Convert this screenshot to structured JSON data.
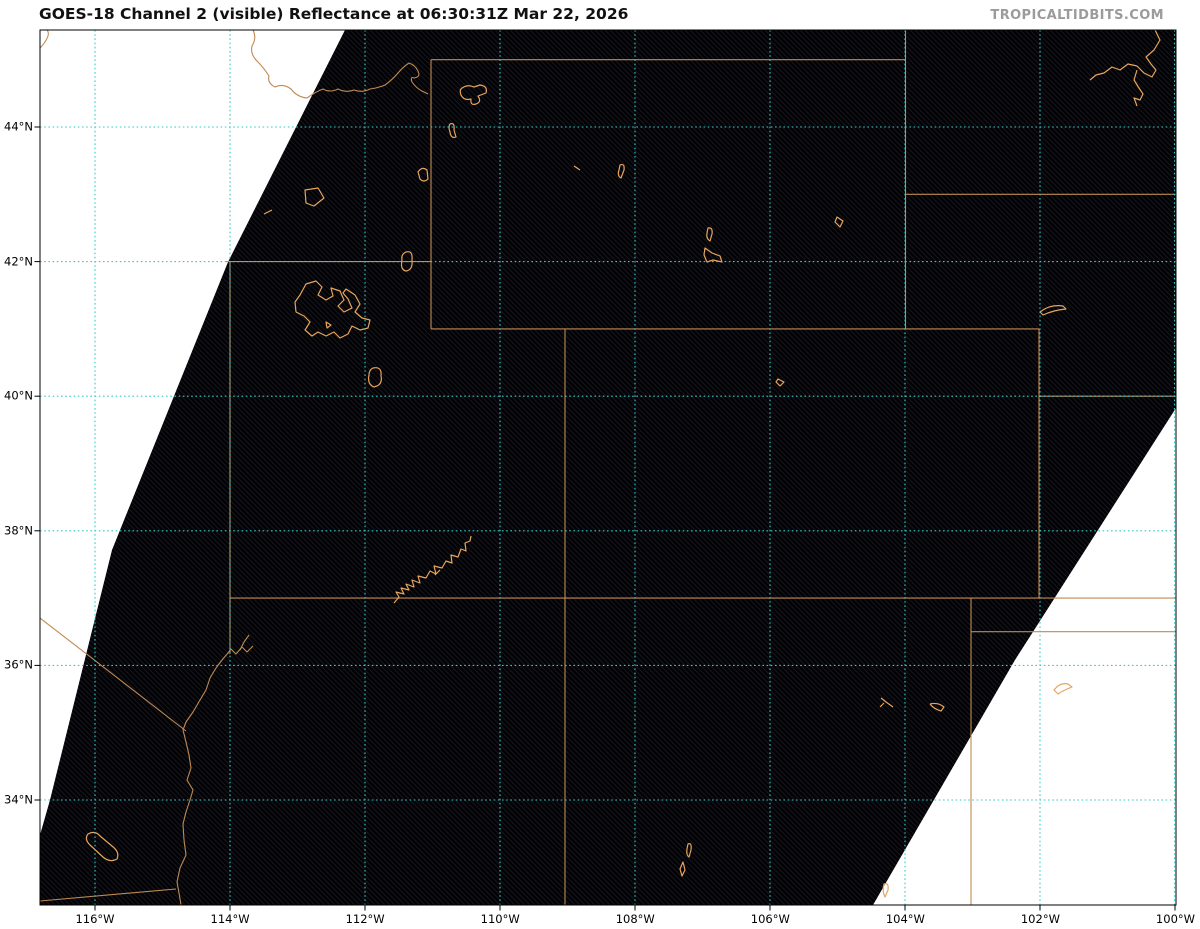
{
  "header": {
    "title": "GOES-18 Channel 2 (visible) Reflectance at 06:30:31Z Mar 22, 2026",
    "watermark": "TROPICALTIDBITS.COM"
  },
  "map": {
    "x_axis_labels": [
      "116°W",
      "114°W",
      "112°W",
      "110°W",
      "108°W",
      "106°W",
      "104°W",
      "102°W",
      "100°W"
    ],
    "y_axis_labels": [
      "44°N",
      "42°N",
      "40°N",
      "38°N",
      "36°N",
      "34°N"
    ],
    "colors": {
      "page_background": "#ffffff",
      "satellite_scan_fill": "#020204",
      "state_border_lines": "#c08a52",
      "water_feature_lines": "#e8a45c",
      "graticule_lines": "#38caca",
      "axis_frame": "#000000",
      "title_text": "#111111",
      "watermark_text": "#9b9b9b"
    }
  }
}
